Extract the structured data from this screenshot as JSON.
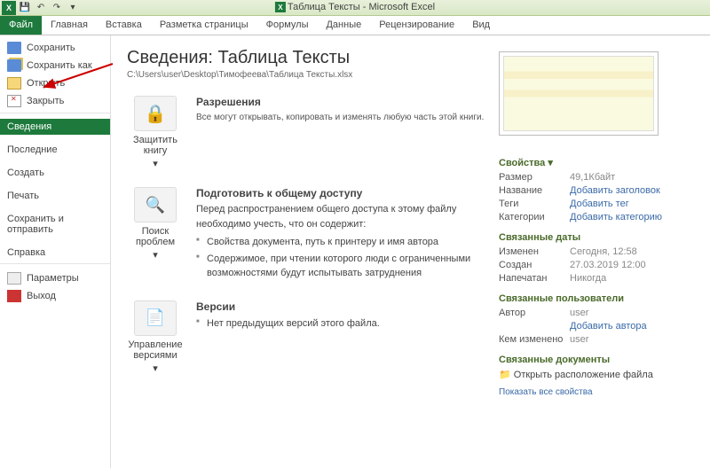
{
  "window": {
    "title": "Таблица Тексты - Microsoft Excel"
  },
  "tabs": [
    "Файл",
    "Главная",
    "Вставка",
    "Разметка страницы",
    "Формулы",
    "Данные",
    "Рецензирование",
    "Вид"
  ],
  "sidebar": {
    "items": [
      {
        "label": "Сохранить",
        "icon": "save"
      },
      {
        "label": "Сохранить как",
        "icon": "saveas"
      },
      {
        "label": "Открыть",
        "icon": "open"
      },
      {
        "label": "Закрыть",
        "icon": "close"
      },
      {
        "label": "Сведения",
        "selected": true
      },
      {
        "label": "Последние"
      },
      {
        "label": "Создать"
      },
      {
        "label": "Печать"
      },
      {
        "label": "Сохранить и отправить"
      },
      {
        "label": "Справка"
      },
      {
        "label": "Параметры",
        "icon": "param"
      },
      {
        "label": "Выход",
        "icon": "exit"
      }
    ]
  },
  "info": {
    "heading": "Сведения: Таблица Тексты",
    "path": "C:\\Users\\user\\Desktop\\Тимофеева\\Таблица Тексты.xlsx",
    "perm": {
      "btn": "Защитить книгу",
      "title": "Разрешения",
      "desc": "Все могут открывать, копировать и изменять любую часть этой книги."
    },
    "share": {
      "btn": "Поиск проблем",
      "title": "Подготовить к общему доступу",
      "desc": "Перед распространением общего доступа к этому файлу необходимо учесть, что он содержит:",
      "items": [
        "Свойства документа, путь к принтеру и имя автора",
        "Содержимое, при чтении которого люди с ограниченными возможностями будут испытывать затруднения"
      ]
    },
    "ver": {
      "btn": "Управление версиями",
      "title": "Версии",
      "items": [
        "Нет предыдущих версий этого файла."
      ]
    }
  },
  "props": {
    "h1": "Свойства ▾",
    "rows1": [
      {
        "k": "Размер",
        "v": "49,1Кбайт"
      },
      {
        "k": "Название",
        "v": "Добавить заголовок",
        "link": true
      },
      {
        "k": "Теги",
        "v": "Добавить тег",
        "link": true
      },
      {
        "k": "Категории",
        "v": "Добавить категорию",
        "link": true
      }
    ],
    "h2": "Связанные даты",
    "rows2": [
      {
        "k": "Изменен",
        "v": "Сегодня, 12:58"
      },
      {
        "k": "Создан",
        "v": "27.03.2019 12:00"
      },
      {
        "k": "Напечатан",
        "v": "Никогда"
      }
    ],
    "h3": "Связанные пользователи",
    "rows3": [
      {
        "k": "Автор",
        "v": "user"
      },
      {
        "k": "",
        "v": "Добавить автора",
        "link": true
      },
      {
        "k": "Кем изменено",
        "v": "user"
      }
    ],
    "h4": "Связанные документы",
    "docloc": "Открыть расположение файла",
    "all": "Показать все свойства"
  }
}
